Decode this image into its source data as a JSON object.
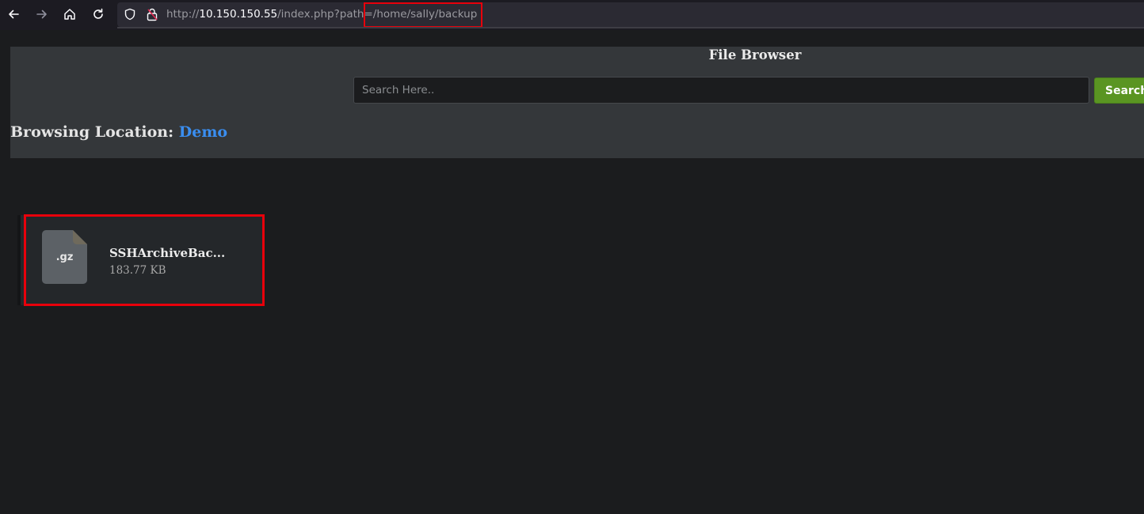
{
  "browser": {
    "url_prefix": "http://",
    "url_host": "10.150.150.55",
    "url_path": "/index.php?path=",
    "url_highlighted": "/home/sally/backup"
  },
  "page": {
    "title": "File Browser",
    "search": {
      "placeholder": "Search Here..",
      "button_label": "Search"
    },
    "location_label": "Browsing Location:",
    "location_link": "Demo"
  },
  "files": [
    {
      "extension": ".gz",
      "name": "SSHArchiveBac...",
      "size": "183.77 KB"
    }
  ],
  "colors": {
    "highlight_box": "#e8000b",
    "link": "#3a8ef0",
    "search_button": "#5a9522"
  },
  "icons": [
    "back-arrow-icon",
    "forward-arrow-icon",
    "home-icon",
    "reload-icon",
    "shield-icon",
    "insecure-lock-icon",
    "file-icon"
  ]
}
